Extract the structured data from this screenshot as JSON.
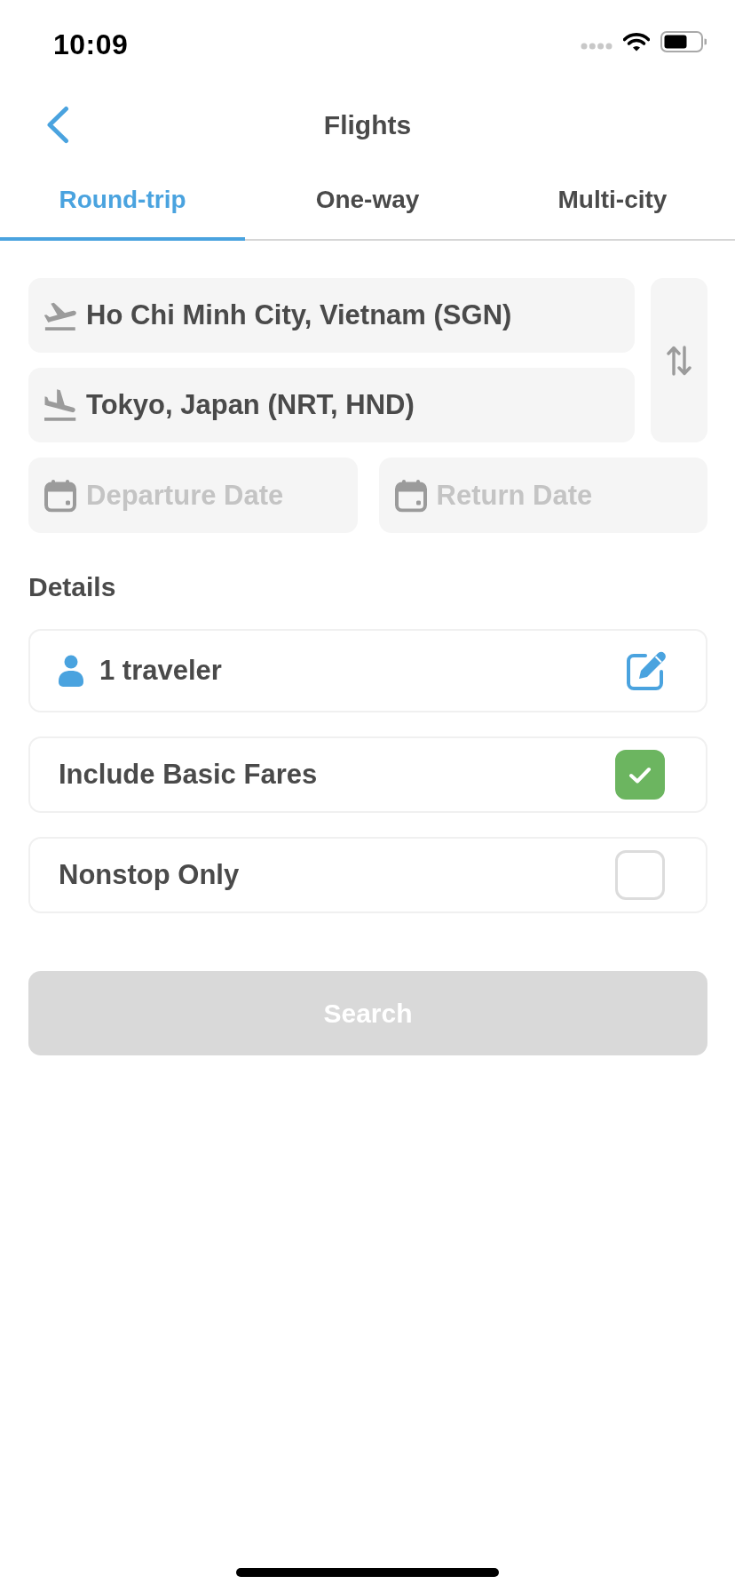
{
  "status_bar": {
    "time": "10:09"
  },
  "header": {
    "title": "Flights"
  },
  "tabs": [
    {
      "label": "Round-trip",
      "selected": true
    },
    {
      "label": "One-way",
      "selected": false
    },
    {
      "label": "Multi-city",
      "selected": false
    }
  ],
  "route": {
    "origin": {
      "value": "Ho Chi Minh City, Vietnam (SGN)"
    },
    "destination": {
      "value": "Tokyo, Japan (NRT, HND)"
    }
  },
  "dates": [
    {
      "placeholder": "Departure Date"
    },
    {
      "placeholder": "Return Date"
    }
  ],
  "details": {
    "heading": "Details",
    "items": [
      {
        "kind": "travelers",
        "label": "1 traveler"
      },
      {
        "kind": "checkbox",
        "label": "Include Basic Fares",
        "checked": true
      },
      {
        "kind": "checkbox",
        "label": "Nonstop Only",
        "checked": false
      }
    ]
  },
  "search_button": {
    "label": "Search",
    "disabled": true
  }
}
